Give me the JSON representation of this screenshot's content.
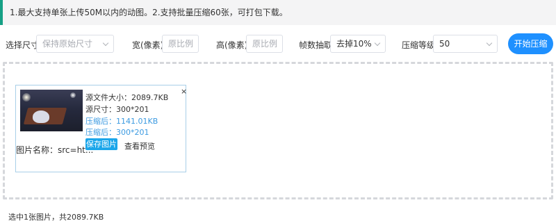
{
  "notice": {
    "text": "1.最大支持单张上传50M以内的动图。2.支持批量压缩60张，可打包下载。"
  },
  "toolbar": {
    "size_label": "选择尺寸",
    "size_select": {
      "value": "保持原始尺寸",
      "icon": "chevron-down-icon"
    },
    "width_label": "宽(像素)",
    "width_input": {
      "placeholder": "原比例"
    },
    "height_label": "高(像素)",
    "height_input": {
      "placeholder": "原比例"
    },
    "frame_label": "帧数抽取",
    "frame_select": {
      "value": "去掉10%",
      "icon": "chevron-down-icon"
    },
    "level_label": "压缩等级",
    "level_select": {
      "value": "50",
      "icon": "chevron-down-icon"
    },
    "start_button": "开始压缩"
  },
  "card": {
    "close": "×",
    "original_size": "源文件大小：2089.7KB",
    "original_dims": "源尺寸：300*201",
    "compressed_size": "压缩后：1141.01KB",
    "compressed_dims": "压缩后：300*201",
    "name": "图片名称：src=ht...",
    "save_button": "保存图片",
    "preview_link": "查看预览"
  },
  "summary": "选中1张图片，共2089.7KB",
  "colors": {
    "accent": "#1e90ff",
    "notice_border": "#16a085",
    "compressed_text": "#3b9ae1"
  }
}
